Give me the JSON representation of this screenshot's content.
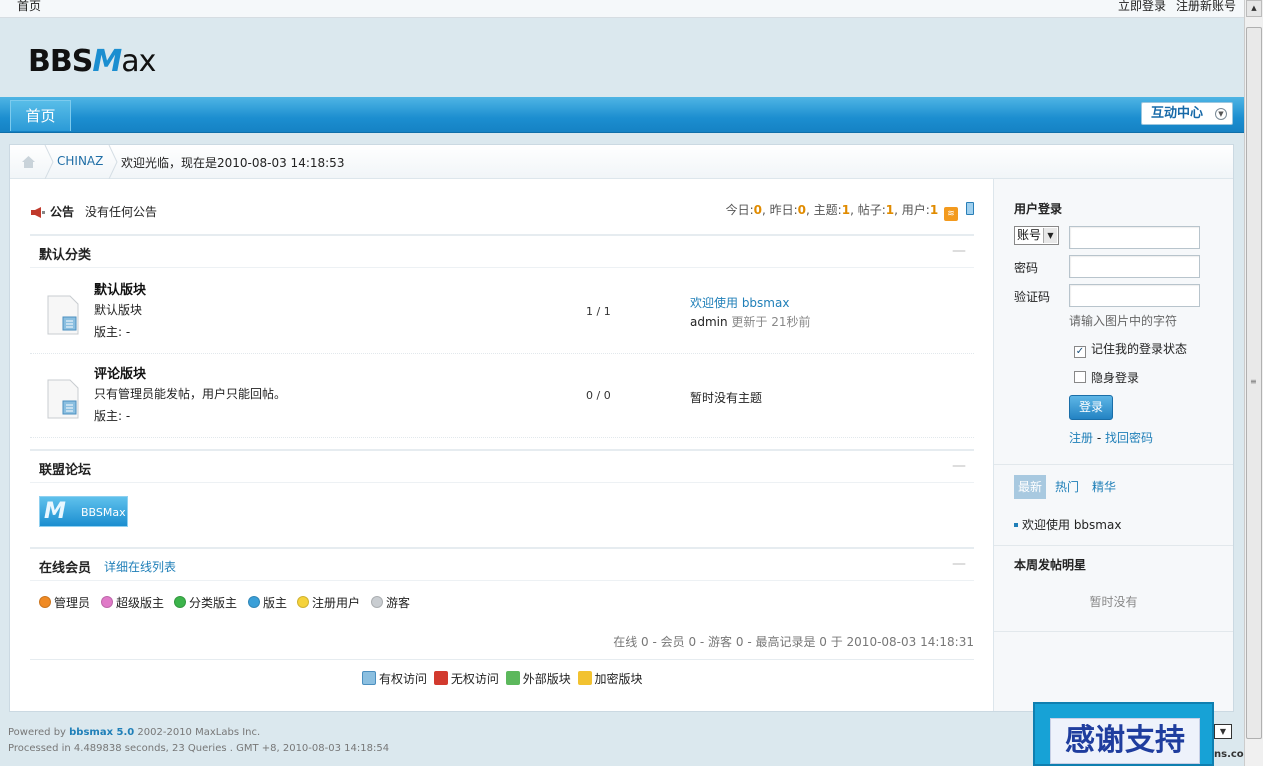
{
  "topbar": {
    "home": "首页",
    "login": "立即登录",
    "register": "注册新账号"
  },
  "logo": {
    "b1": "BBS",
    "m": "M",
    "ax": "ax"
  },
  "nav": {
    "home_tab": "首页",
    "interact": "互动中心"
  },
  "breadcrumb": {
    "site": "CHINAZ",
    "welcome": "欢迎光临，现在是2010-08-03 14:18:53"
  },
  "announcement": {
    "label": "公告",
    "text": "没有任何公告"
  },
  "stats": {
    "today_label": "今日:",
    "today": "0",
    "yesterday_label": ", 昨日:",
    "yesterday": "0",
    "topics_label": ", 主题:",
    "topics": "1",
    "posts_label": ", 帖子:",
    "posts": "1",
    "users_label": ", 用户:",
    "users": "1"
  },
  "categories": {
    "default": {
      "title": "默认分类",
      "collapse": "—"
    },
    "alliance": {
      "title": "联盟论坛",
      "collapse": "—",
      "badge": "BBSMax"
    },
    "online": {
      "title": "在线会员",
      "link": "详细在线列表",
      "collapse": "—"
    }
  },
  "forums": [
    {
      "name": "默认版块",
      "desc": "默认版块",
      "mod": "版主: -",
      "count": "1 / 1",
      "last_title": "欢迎使用 bbsmax",
      "last_user": "admin",
      "last_time": " 更新于 21秒前"
    },
    {
      "name": "评论版块",
      "desc": "只有管理员能发帖，用户只能回帖。",
      "mod": "版主: -",
      "count": "0 / 0",
      "last_none": "暂时没有主题"
    }
  ],
  "legend": [
    "管理员",
    "超级版主",
    "分类版主",
    "版主",
    "注册用户",
    "游客"
  ],
  "online_stats": "在线 0 - 会员 0 - 游客 0 - 最高记录是 0 于 2010-08-03 14:18:31",
  "access": [
    "有权访问",
    "无权访问",
    "外部版块",
    "加密版块"
  ],
  "colors": {
    "accent": "#1b8ed0",
    "link": "#1f7fb8",
    "stat_num": "#e08b00"
  },
  "sidebar": {
    "login_title": "用户登录",
    "account_select": "账号",
    "password_label": "密码",
    "captcha_label": "验证码",
    "captcha_hint": "请输入图片中的字符",
    "remember": "记住我的登录状态",
    "invisible": "隐身登录",
    "login_button": "登录",
    "register_link": "注册",
    "link_sep": " - ",
    "recover_link": "找回密码",
    "tabs": [
      "最新",
      "热门",
      "精华"
    ],
    "latest_topic": "欢迎使用 bbsmax",
    "stars_title": "本周发帖明星",
    "stars_empty": "暂时没有"
  },
  "footer": {
    "powered_prefix": "Powered by ",
    "product": "bbsmax 5.0",
    "powered_suffix": " 2002-2010 MaxLabs Inc.",
    "processed": "Processed in 4.489838 seconds, 23 Queries . GMT +8, 2010-08-03 14:18:54"
  },
  "promo": {
    "text": "感谢支持"
  },
  "watermark": "ns.com"
}
